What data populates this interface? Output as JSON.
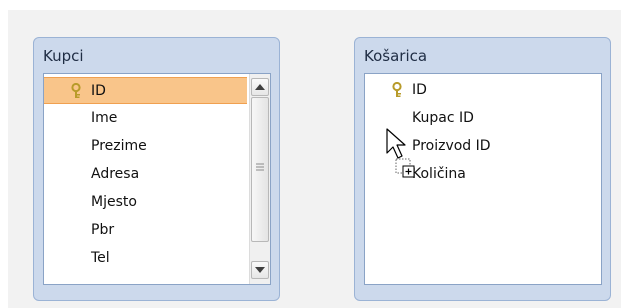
{
  "tables": {
    "kupci": {
      "title": "Kupci",
      "fields": [
        {
          "name": "ID",
          "primary_key": true,
          "selected": true
        },
        {
          "name": "Ime"
        },
        {
          "name": "Prezime"
        },
        {
          "name": "Adresa"
        },
        {
          "name": "Mjesto"
        },
        {
          "name": "Pbr"
        },
        {
          "name": "Tel"
        }
      ]
    },
    "kosarica": {
      "title": "Košarica",
      "fields": [
        {
          "name": "ID",
          "primary_key": true
        },
        {
          "name": "Kupac ID"
        },
        {
          "name": "Proizvod ID"
        },
        {
          "name": "Količina"
        }
      ]
    }
  },
  "colors": {
    "table_frame": "#ccd9ec",
    "selected_row": "#f9c58a",
    "key_icon": "#b89b2a"
  },
  "icons": {
    "primary_key": "key-icon",
    "cursor": "drag-link-cursor",
    "scroll_up": "triangle-up-icon",
    "scroll_down": "triangle-down-icon"
  }
}
